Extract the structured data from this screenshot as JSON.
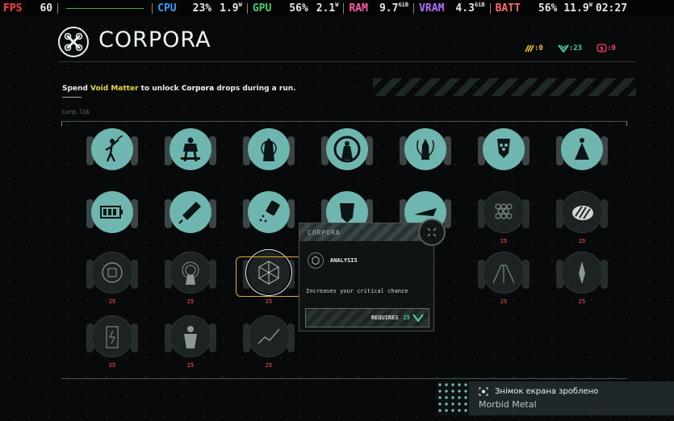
{
  "overlay": {
    "fps_label": "FPS",
    "fps_value": "60",
    "cpu_label": "CPU",
    "cpu_load": "23%",
    "cpu_power": "1.9",
    "cpu_power_unit": "W",
    "gpu_label": "GPU",
    "gpu_load": "56%",
    "gpu_power": "2.1",
    "gpu_power_unit": "W",
    "ram_label": "RAM",
    "ram_value": "9.7",
    "ram_unit": "GiB",
    "vram_label": "VRAM",
    "vram_value": "4.3",
    "vram_unit": "GiB",
    "batt_label": "BATT",
    "batt_percent": "56%",
    "batt_power": "11.9",
    "batt_power_unit": "W",
    "clock": "02:27",
    "colors": {
      "fps": "#ff3b3b",
      "cpu": "#3a9bff",
      "gpu": "#3fcf6a",
      "ram": "#ff5aa8",
      "vram": "#b56bff",
      "batt": "#ff6a6a"
    }
  },
  "header": {
    "title": "CORPORA",
    "currencies": [
      {
        "icon": "claw-icon",
        "value": ":0",
        "color": "#f0c020"
      },
      {
        "icon": "void-v-icon",
        "value": ":23",
        "color": "#47d39c"
      },
      {
        "icon": "dollar-shield-icon",
        "value": ":0",
        "color": "#ff3a6e"
      }
    ]
  },
  "intro": {
    "part1": "Spend ",
    "highlight": "Void Matter",
    "part2": " to unlock ",
    "bold": "Corpora",
    "part3": " drops during a run."
  },
  "library_label": "Corp.lib",
  "grid": {
    "rows": [
      [
        {
          "icon": "swordsman-icon",
          "cost": ""
        },
        {
          "icon": "brute-icon",
          "cost": ""
        },
        {
          "icon": "hooded-figure-icon",
          "cost": ""
        },
        {
          "icon": "sage-icon",
          "cost": ""
        },
        {
          "icon": "reaper-icon",
          "cost": ""
        },
        {
          "icon": "masked-warrior-icon",
          "cost": ""
        },
        {
          "icon": "caped-figure-icon",
          "cost": ""
        }
      ],
      [
        {
          "icon": "battery-icon",
          "cost": ""
        },
        {
          "icon": "syringe-icon",
          "cost": ""
        },
        {
          "icon": "salt-shaker-icon",
          "cost": ""
        },
        {
          "icon": "mask-icon",
          "cost": ""
        },
        {
          "icon": "ship-icon",
          "cost": ""
        },
        {
          "icon": "hexagon-grid-icon",
          "cost": "25"
        },
        {
          "icon": "claw-mark-icon",
          "cost": "25"
        }
      ],
      [
        {
          "icon": "brain-chip-icon",
          "cost": "25"
        },
        {
          "icon": "radar-figure-icon",
          "cost": "25"
        },
        {
          "icon": "analysis-icon",
          "cost": "25"
        },
        {
          "icon": "hidden-icon",
          "cost": ""
        },
        {
          "icon": "hidden-icon",
          "cost": ""
        },
        {
          "icon": "tunnel-icon",
          "cost": "25"
        },
        {
          "icon": "blade-icon",
          "cost": "25"
        }
      ],
      [
        {
          "icon": "energy-cell-icon",
          "cost": "25"
        },
        {
          "icon": "target-dummy-icon",
          "cost": "25"
        },
        {
          "icon": "graph-icon",
          "cost": "25"
        }
      ]
    ]
  },
  "tooltip": {
    "header": "CORPORA",
    "name": "ANALYSIS",
    "description": "Increases your critical chance",
    "requires_label": "REQUIRES",
    "requires_value": "25"
  },
  "toast": {
    "title": "Знімок екрана зроблено",
    "app": "Morbid Metal"
  }
}
